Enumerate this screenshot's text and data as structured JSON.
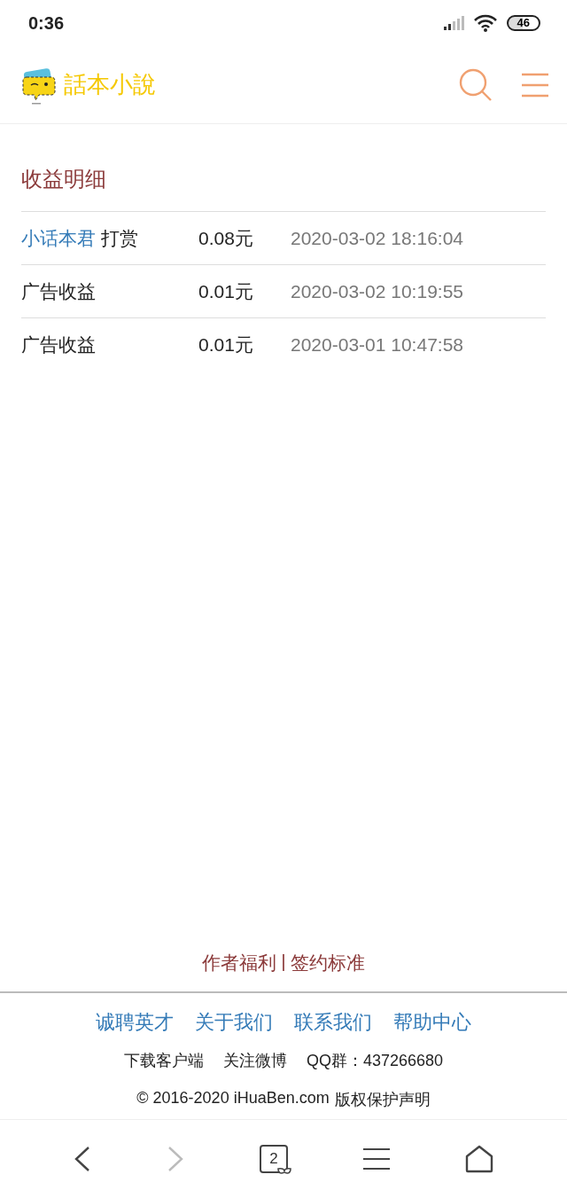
{
  "status_bar": {
    "time": "0:36",
    "battery": "46"
  },
  "header": {
    "logo_text": "話本小說"
  },
  "section": {
    "title": "收益明细"
  },
  "records": [
    {
      "user": "小话本君",
      "action": "打赏",
      "amount": "0.08元",
      "time": "2020-03-02 18:16:04"
    },
    {
      "action": "广告收益",
      "amount": "0.01元",
      "time": "2020-03-02 10:19:55"
    },
    {
      "action": "广告收益",
      "amount": "0.01元",
      "time": "2020-03-01 10:47:58"
    }
  ],
  "author_links": [
    "作者福利",
    "签约标准"
  ],
  "author_separator": "|",
  "footer_links": [
    "诚聘英才",
    "关于我们",
    "联系我们",
    "帮助中心"
  ],
  "footer_info": [
    "下载客户端",
    "关注微博",
    "QQ群：437266680"
  ],
  "copyright": [
    "© 2016-2020 iHuaBen.com",
    "版权保护声明"
  ],
  "browser_nav": {
    "back_disabled": false,
    "forward_disabled": true,
    "tab_count": "2"
  }
}
